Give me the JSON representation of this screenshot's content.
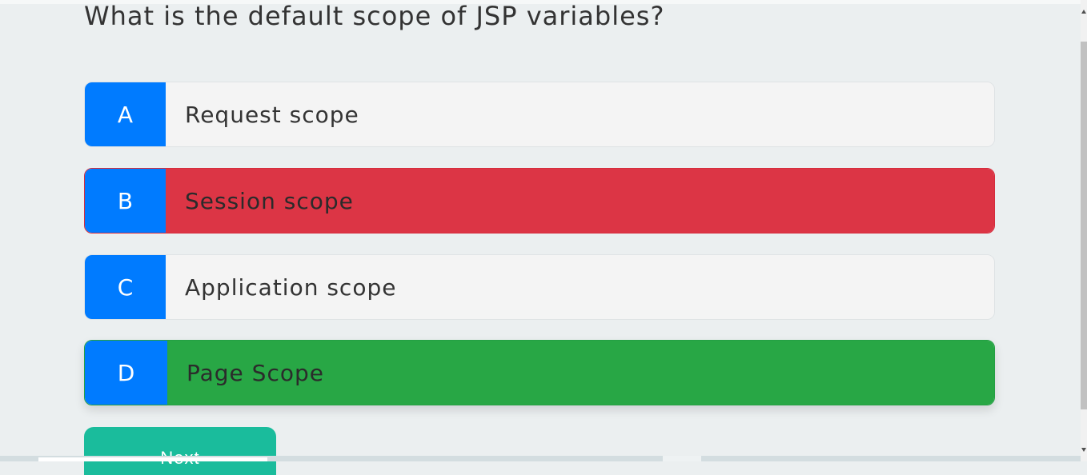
{
  "question": "What is the default scope of JSP variables?",
  "options": [
    {
      "letter": "A",
      "text": "Request scope",
      "state": "neutral"
    },
    {
      "letter": "B",
      "text": "Session scope",
      "state": "wrong"
    },
    {
      "letter": "C",
      "text": "Application scope",
      "state": "neutral"
    },
    {
      "letter": "D",
      "text": "Page Scope",
      "state": "correct"
    }
  ],
  "next_label": "Next",
  "colors": {
    "letter_bg": "#007bff",
    "wrong": "#dc3545",
    "correct": "#28a745",
    "neutral": "#f4f4f4",
    "next_button": "#1abc9c",
    "page_bg": "#ebeff0"
  }
}
